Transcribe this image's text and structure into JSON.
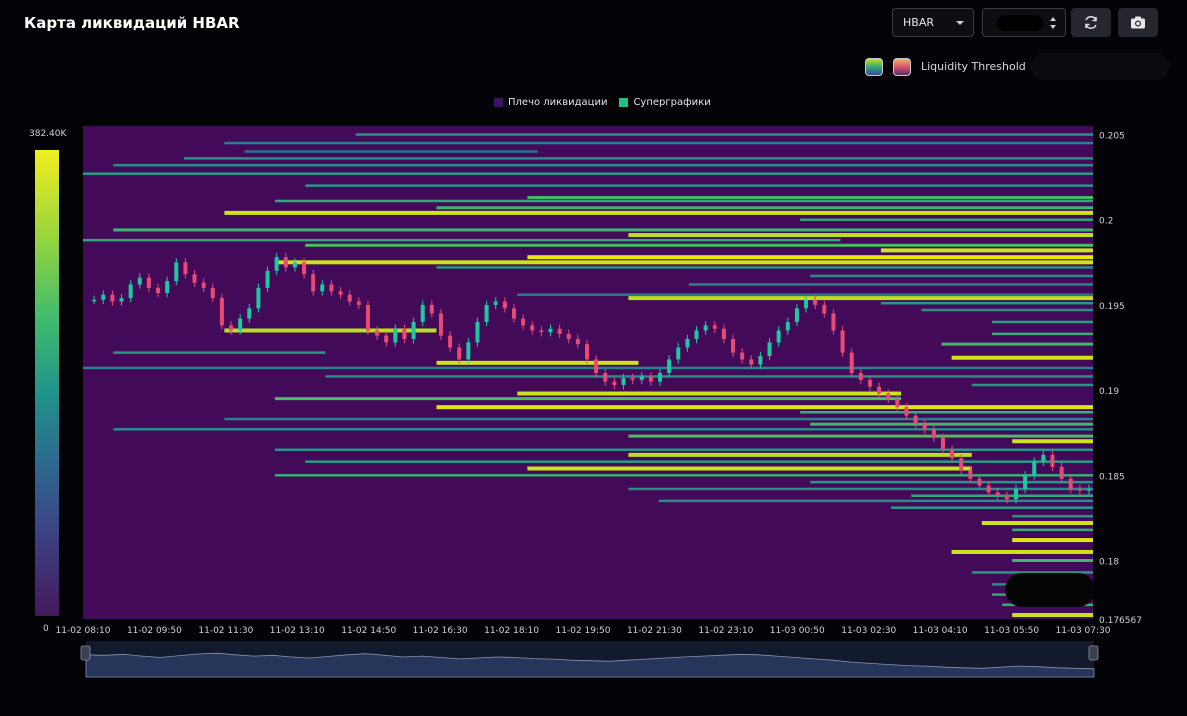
{
  "header": {
    "title": "Карта ликвидаций HBAR",
    "symbol_select": "HBAR",
    "liquidity_threshold_label": "Liquidity Threshold ="
  },
  "icons": {
    "refresh": "refresh-icon",
    "camera": "camera-icon",
    "caret": "chevron-down-icon",
    "stepper": "stepper-icon"
  },
  "colors": {
    "background": "#030307",
    "plot_background": "#440a5a",
    "candle_up": "#1fc9a0",
    "candle_down": "#e84a73",
    "level_high": "#f0ea0f",
    "level_mid": "#35bb6e",
    "level_low": "#2a8a8f",
    "navigator_fill": "#26365a"
  },
  "chart_data": {
    "type": "heatmap",
    "legend": [
      {
        "name": "Плечо ликвидации",
        "color": "#3b1265"
      },
      {
        "name": "Суперграфики",
        "color": "#19c48a"
      }
    ],
    "colorbar": {
      "max_label": "382.40K",
      "min_label": "0"
    },
    "x_ticks": [
      "11-02 08:10",
      "11-02 09:50",
      "11-02 11:30",
      "11-02 13:10",
      "11-02 14:50",
      "11-02 16:30",
      "11-02 18:10",
      "11-02 19:50",
      "11-02 21:30",
      "11-02 23:10",
      "11-03 00:50",
      "11-03 02:30",
      "11-03 04:10",
      "11-03 05:50",
      "11-03 07:30"
    ],
    "y_ticks": [
      "0.205",
      "0.2",
      "0.195",
      "0.19",
      "0.185",
      "0.18",
      "0.176567"
    ],
    "ylim": [
      0.176567,
      0.2055
    ],
    "price_series": [
      [
        0,
        0.1953
      ],
      [
        0.5,
        0.1953
      ],
      [
        1,
        0.1956
      ],
      [
        1.5,
        0.1952
      ],
      [
        2,
        0.1954
      ],
      [
        2.5,
        0.1962
      ],
      [
        3,
        0.1966
      ],
      [
        3.5,
        0.196
      ],
      [
        4,
        0.1957
      ],
      [
        4.5,
        0.1964
      ],
      [
        5,
        0.1975
      ],
      [
        5.5,
        0.1968
      ],
      [
        6,
        0.1963
      ],
      [
        6.5,
        0.196
      ],
      [
        7,
        0.1954
      ],
      [
        7.5,
        0.1938
      ],
      [
        8,
        0.1935
      ],
      [
        8.5,
        0.1942
      ],
      [
        9,
        0.1948
      ],
      [
        9.5,
        0.196
      ],
      [
        10,
        0.197
      ],
      [
        10.5,
        0.1978
      ],
      [
        11,
        0.1972
      ],
      [
        11.5,
        0.1975
      ],
      [
        12,
        0.1968
      ],
      [
        12.5,
        0.1958
      ],
      [
        13,
        0.1962
      ],
      [
        13.5,
        0.1958
      ],
      [
        14,
        0.1956
      ],
      [
        14.5,
        0.1952
      ],
      [
        15,
        0.195
      ],
      [
        15.5,
        0.1935
      ],
      [
        16,
        0.1932
      ],
      [
        16.5,
        0.1928
      ],
      [
        17,
        0.1936
      ],
      [
        17.5,
        0.193
      ],
      [
        18,
        0.194
      ],
      [
        18.5,
        0.195
      ],
      [
        19,
        0.1945
      ],
      [
        19.5,
        0.1932
      ],
      [
        20,
        0.1925
      ],
      [
        20.5,
        0.1918
      ],
      [
        21,
        0.1928
      ],
      [
        21.5,
        0.194
      ],
      [
        22,
        0.195
      ],
      [
        22.5,
        0.1952
      ],
      [
        23,
        0.1948
      ],
      [
        23.5,
        0.1942
      ],
      [
        24,
        0.1938
      ],
      [
        24.5,
        0.1935
      ],
      [
        25,
        0.1934
      ],
      [
        25.5,
        0.1936
      ],
      [
        26,
        0.1933
      ],
      [
        26.5,
        0.193
      ],
      [
        27,
        0.1927
      ],
      [
        27.5,
        0.1918
      ],
      [
        28,
        0.191
      ],
      [
        28.5,
        0.1905
      ],
      [
        29,
        0.1903
      ],
      [
        29.5,
        0.1907
      ],
      [
        30,
        0.1906
      ],
      [
        30.5,
        0.1908
      ],
      [
        31,
        0.1905
      ],
      [
        31.5,
        0.191
      ],
      [
        32,
        0.1918
      ],
      [
        32.5,
        0.1925
      ],
      [
        33,
        0.193
      ],
      [
        33.5,
        0.1935
      ],
      [
        34,
        0.1938
      ],
      [
        34.5,
        0.1936
      ],
      [
        35,
        0.193
      ],
      [
        35.5,
        0.1922
      ],
      [
        36,
        0.1918
      ],
      [
        36.5,
        0.1915
      ],
      [
        37,
        0.192
      ],
      [
        37.5,
        0.1928
      ],
      [
        38,
        0.1935
      ],
      [
        38.5,
        0.194
      ],
      [
        39,
        0.1948
      ],
      [
        39.5,
        0.1953
      ],
      [
        40,
        0.195
      ],
      [
        40.5,
        0.1945
      ],
      [
        41,
        0.1935
      ],
      [
        41.5,
        0.1922
      ],
      [
        42,
        0.191
      ],
      [
        42.5,
        0.1906
      ],
      [
        43,
        0.1902
      ],
      [
        43.5,
        0.1898
      ],
      [
        44,
        0.1895
      ],
      [
        44.5,
        0.189
      ],
      [
        45,
        0.1885
      ],
      [
        45.5,
        0.188
      ],
      [
        46,
        0.1877
      ],
      [
        46.5,
        0.1872
      ],
      [
        47,
        0.1865
      ],
      [
        47.5,
        0.186
      ],
      [
        48,
        0.1853
      ],
      [
        48.5,
        0.1848
      ],
      [
        49,
        0.1844
      ],
      [
        49.5,
        0.184
      ],
      [
        50,
        0.1838
      ],
      [
        50.5,
        0.1836
      ],
      [
        51,
        0.1842
      ],
      [
        51.5,
        0.185
      ],
      [
        52,
        0.1858
      ],
      [
        52.5,
        0.1862
      ],
      [
        53,
        0.1855
      ],
      [
        53.5,
        0.1848
      ],
      [
        54,
        0.1842
      ],
      [
        54.5,
        0.1841
      ],
      [
        55,
        0.1842
      ]
    ],
    "levels": [
      {
        "price": 0.205,
        "x0": 0.27,
        "x1": 1,
        "c": 0.35
      },
      {
        "price": 0.2045,
        "x0": 0.14,
        "x1": 1,
        "c": 0.25
      },
      {
        "price": 0.204,
        "x0": 0.16,
        "x1": 0.45,
        "c": 0.2
      },
      {
        "price": 0.2036,
        "x0": 0.1,
        "x1": 1,
        "c": 0.3
      },
      {
        "price": 0.2032,
        "x0": 0.03,
        "x1": 1,
        "c": 0.3
      },
      {
        "price": 0.2027,
        "x0": 0.0,
        "x1": 1,
        "c": 0.4
      },
      {
        "price": 0.202,
        "x0": 0.22,
        "x1": 1,
        "c": 0.35
      },
      {
        "price": 0.2013,
        "x0": 0.44,
        "x1": 1,
        "c": 0.6
      },
      {
        "price": 0.2011,
        "x0": 0.19,
        "x1": 1,
        "c": 0.45
      },
      {
        "price": 0.2007,
        "x0": 0.35,
        "x1": 1,
        "c": 0.55
      },
      {
        "price": 0.2004,
        "x0": 0.14,
        "x1": 1,
        "c": 0.9
      },
      {
        "price": 0.2,
        "x0": 0.71,
        "x1": 1,
        "c": 0.45
      },
      {
        "price": 0.1994,
        "x0": 0.03,
        "x1": 1,
        "c": 0.55
      },
      {
        "price": 0.1991,
        "x0": 0.54,
        "x1": 1,
        "c": 0.85
      },
      {
        "price": 0.1988,
        "x0": 0.0,
        "x1": 0.75,
        "c": 0.45
      },
      {
        "price": 0.1985,
        "x0": 0.22,
        "x1": 1,
        "c": 0.6
      },
      {
        "price": 0.1982,
        "x0": 0.79,
        "x1": 1,
        "c": 0.9
      },
      {
        "price": 0.1978,
        "x0": 0.44,
        "x1": 1,
        "c": 0.98
      },
      {
        "price": 0.1975,
        "x0": 0.19,
        "x1": 1,
        "c": 0.9
      },
      {
        "price": 0.1972,
        "x0": 0.35,
        "x1": 1,
        "c": 0.35
      },
      {
        "price": 0.1967,
        "x0": 0.72,
        "x1": 1,
        "c": 0.3
      },
      {
        "price": 0.1962,
        "x0": 0.6,
        "x1": 1,
        "c": 0.25
      },
      {
        "price": 0.1956,
        "x0": 0.43,
        "x1": 1,
        "c": 0.2
      },
      {
        "price": 0.1954,
        "x0": 0.54,
        "x1": 1,
        "c": 0.85
      },
      {
        "price": 0.1951,
        "x0": 0.79,
        "x1": 1,
        "c": 0.35
      },
      {
        "price": 0.1947,
        "x0": 0.83,
        "x1": 1,
        "c": 0.3
      },
      {
        "price": 0.194,
        "x0": 0.9,
        "x1": 1,
        "c": 0.4
      },
      {
        "price": 0.1935,
        "x0": 0.14,
        "x1": 0.35,
        "c": 0.85
      },
      {
        "price": 0.1933,
        "x0": 0.9,
        "x1": 1,
        "c": 0.5
      },
      {
        "price": 0.1927,
        "x0": 0.85,
        "x1": 1,
        "c": 0.55
      },
      {
        "price": 0.1922,
        "x0": 0.03,
        "x1": 0.24,
        "c": 0.35
      },
      {
        "price": 0.1919,
        "x0": 0.86,
        "x1": 1,
        "c": 0.9
      },
      {
        "price": 0.1916,
        "x0": 0.35,
        "x1": 0.55,
        "c": 0.9
      },
      {
        "price": 0.1913,
        "x0": 0.0,
        "x1": 1,
        "c": 0.25
      },
      {
        "price": 0.1908,
        "x0": 0.24,
        "x1": 1,
        "c": 0.3
      },
      {
        "price": 0.1903,
        "x0": 0.88,
        "x1": 1,
        "c": 0.35
      },
      {
        "price": 0.1898,
        "x0": 0.43,
        "x1": 0.81,
        "c": 0.9
      },
      {
        "price": 0.1895,
        "x0": 0.19,
        "x1": 0.81,
        "c": 0.6
      },
      {
        "price": 0.189,
        "x0": 0.35,
        "x1": 1,
        "c": 0.95
      },
      {
        "price": 0.1887,
        "x0": 0.71,
        "x1": 1,
        "c": 0.5
      },
      {
        "price": 0.1883,
        "x0": 0.14,
        "x1": 1,
        "c": 0.25
      },
      {
        "price": 0.188,
        "x0": 0.72,
        "x1": 1,
        "c": 0.55
      },
      {
        "price": 0.1877,
        "x0": 0.03,
        "x1": 1,
        "c": 0.3
      },
      {
        "price": 0.1873,
        "x0": 0.54,
        "x1": 1,
        "c": 0.6
      },
      {
        "price": 0.187,
        "x0": 0.92,
        "x1": 1,
        "c": 0.9
      },
      {
        "price": 0.1865,
        "x0": 0.19,
        "x1": 1,
        "c": 0.35
      },
      {
        "price": 0.1862,
        "x0": 0.54,
        "x1": 0.88,
        "c": 0.85
      },
      {
        "price": 0.1858,
        "x0": 0.22,
        "x1": 1,
        "c": 0.4
      },
      {
        "price": 0.1854,
        "x0": 0.44,
        "x1": 0.88,
        "c": 0.9
      },
      {
        "price": 0.185,
        "x0": 0.19,
        "x1": 1,
        "c": 0.5
      },
      {
        "price": 0.1846,
        "x0": 0.72,
        "x1": 1,
        "c": 0.35
      },
      {
        "price": 0.1842,
        "x0": 0.54,
        "x1": 1,
        "c": 0.3
      },
      {
        "price": 0.1838,
        "x0": 0.82,
        "x1": 1,
        "c": 0.45
      },
      {
        "price": 0.1835,
        "x0": 0.57,
        "x1": 1,
        "c": 0.3
      },
      {
        "price": 0.1831,
        "x0": 0.8,
        "x1": 1,
        "c": 0.4
      },
      {
        "price": 0.1826,
        "x0": 0.92,
        "x1": 1,
        "c": 0.35
      },
      {
        "price": 0.1822,
        "x0": 0.89,
        "x1": 1,
        "c": 0.9
      },
      {
        "price": 0.1818,
        "x0": 0.92,
        "x1": 1,
        "c": 0.5
      },
      {
        "price": 0.1812,
        "x0": 0.92,
        "x1": 1,
        "c": 0.95
      },
      {
        "price": 0.1805,
        "x0": 0.86,
        "x1": 1,
        "c": 0.9
      },
      {
        "price": 0.18,
        "x0": 0.92,
        "x1": 1,
        "c": 0.55
      },
      {
        "price": 0.1793,
        "x0": 0.88,
        "x1": 1,
        "c": 0.35
      },
      {
        "price": 0.1786,
        "x0": 0.9,
        "x1": 1,
        "c": 0.3
      },
      {
        "price": 0.178,
        "x0": 0.9,
        "x1": 1,
        "c": 0.45
      },
      {
        "price": 0.1774,
        "x0": 0.91,
        "x1": 1,
        "c": 0.5
      },
      {
        "price": 0.1768,
        "x0": 0.92,
        "x1": 1,
        "c": 0.9
      }
    ],
    "navigator": [
      0.6,
      0.58,
      0.62,
      0.55,
      0.5,
      0.57,
      0.63,
      0.66,
      0.6,
      0.55,
      0.58,
      0.52,
      0.48,
      0.54,
      0.6,
      0.64,
      0.58,
      0.52,
      0.55,
      0.5,
      0.45,
      0.48,
      0.52,
      0.5,
      0.46,
      0.44,
      0.4,
      0.38,
      0.36,
      0.4,
      0.44,
      0.48,
      0.52,
      0.55,
      0.58,
      0.62,
      0.6,
      0.55,
      0.5,
      0.45,
      0.4,
      0.33,
      0.28,
      0.24,
      0.2,
      0.18,
      0.14,
      0.12,
      0.1,
      0.14,
      0.18,
      0.16,
      0.12,
      0.1,
      0.08
    ]
  }
}
